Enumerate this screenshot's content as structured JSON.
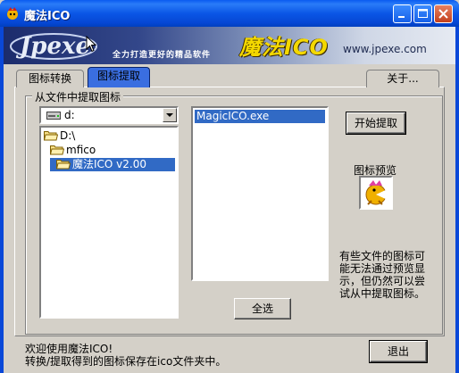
{
  "window": {
    "title": "魔法ICO"
  },
  "banner": {
    "logo_text": "Jpexe",
    "slogan": "全力打造更好的精品软件",
    "title": "魔法ICO",
    "url": "www.jpexe.com"
  },
  "tabs": [
    {
      "label": "图标转换"
    },
    {
      "label": "图标提取"
    },
    {
      "label": "关于..."
    }
  ],
  "group": {
    "label": "从文件中提取图标"
  },
  "drive": {
    "value": "d:"
  },
  "directories": [
    {
      "label": "D:\\"
    },
    {
      "label": "mfico"
    },
    {
      "label": "魔法ICO v2.00"
    }
  ],
  "files": [
    {
      "label": "MagicICO.exe"
    }
  ],
  "buttons": {
    "start": "开始提取",
    "select_all": "全选",
    "exit": "退出"
  },
  "preview": {
    "label": "图标预览",
    "icon": "pacman-character-icon"
  },
  "note": "有些文件的图标可能无法通过预览显示，但仍然可以尝试从中提取图标。",
  "status": {
    "line1": "欢迎使用魔法ICO!",
    "line2": "转换/提取得到的图标保存在ico文件夹中。"
  },
  "colors": {
    "titlebar": "#0a56e6",
    "selection": "#316ac5",
    "face": "#d4d0c8"
  }
}
